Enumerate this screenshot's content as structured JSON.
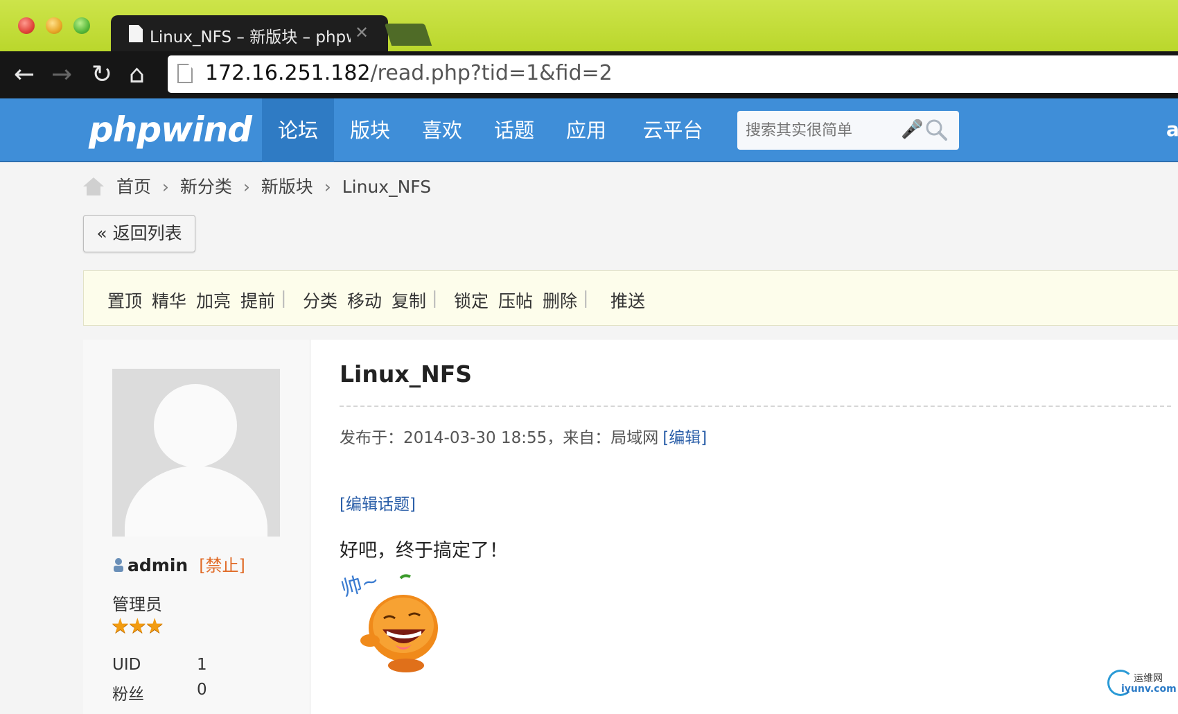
{
  "browser": {
    "tab_title": "Linux_NFS – 新版块 – phpwi",
    "tab_close": "✕",
    "url_host": "172.16.251.182",
    "url_path": "/read.php?tid=1&fid=2"
  },
  "header": {
    "logo": "phpwind",
    "nav": [
      "论坛",
      "版块",
      "喜欢",
      "话题",
      "应用",
      "云平台"
    ],
    "active_nav": "论坛",
    "search_placeholder": "搜索其实很简单",
    "user_abbr": "a"
  },
  "breadcrumb": [
    "首页",
    "新分类",
    "新版块",
    "Linux_NFS"
  ],
  "back_button": "« 返回列表",
  "mod_toolbar": {
    "group1": [
      "置顶",
      "精华",
      "加亮",
      "提前"
    ],
    "group2": [
      "分类",
      "移动",
      "复制"
    ],
    "group3": [
      "锁定",
      "压帖",
      "删除"
    ],
    "group4": [
      "推送"
    ],
    "separator": "|"
  },
  "author": {
    "username": "admin",
    "ban_link": "[禁止]",
    "role": "管理员",
    "stars": "★★★",
    "star_count": 3,
    "stats": [
      {
        "label": "UID",
        "value": "1"
      },
      {
        "label": "粉丝",
        "value": "0"
      }
    ]
  },
  "post": {
    "title": "Linux_NFS",
    "meta_prefix": "发布于：",
    "meta_datetime": "2014-03-30 18:55",
    "meta_from_label": "，来自：",
    "meta_from": "局域网",
    "edit_link": "[编辑]",
    "edit_topic_link": "[编辑话题]",
    "body": "好吧，终于搞定了！",
    "emoji_caption": "帅~"
  },
  "watermark": {
    "line1": "运维网",
    "line2": "iyunv.com"
  },
  "colors": {
    "header_blue": "#3f8ed8",
    "link_blue": "#2a5ea8",
    "ban_orange": "#e06a26",
    "star_orange": "#f29c11",
    "chrome_green": "#b9d62a"
  }
}
